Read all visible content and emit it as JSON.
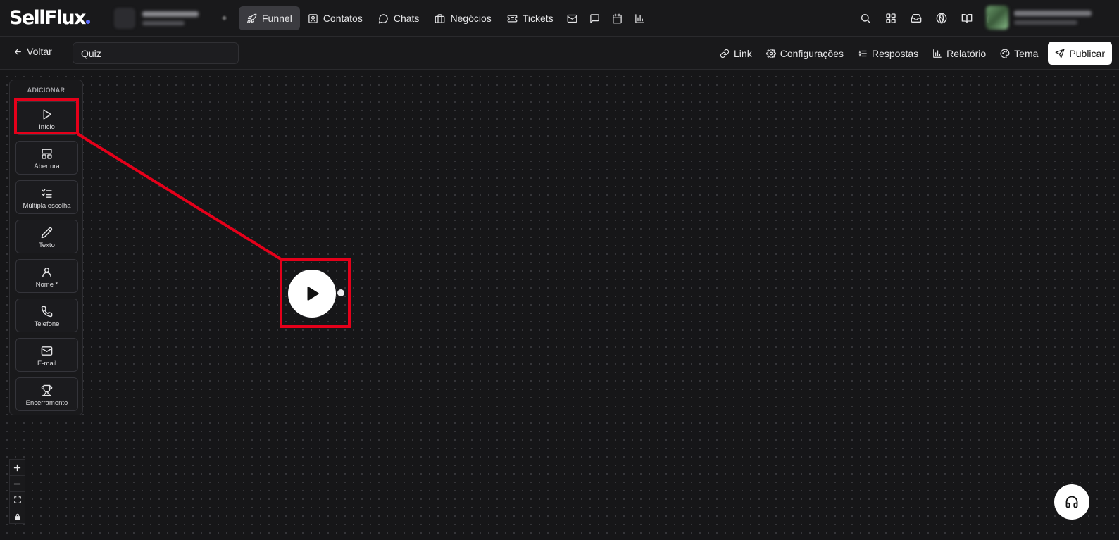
{
  "brand": {
    "name": "SellFlux",
    "dot_color": "#5a6bff"
  },
  "nav": {
    "items": [
      {
        "label": "Funnel",
        "icon": "rocket-icon",
        "active": true
      },
      {
        "label": "Contatos",
        "icon": "contact-card-icon"
      },
      {
        "label": "Chats",
        "icon": "chat-bubble-icon"
      },
      {
        "label": "Negócios",
        "icon": "briefcase-icon"
      },
      {
        "label": "Tickets",
        "icon": "ticket-icon"
      }
    ],
    "extra_icons": [
      "mail-icon",
      "message-square-icon",
      "calendar-icon",
      "bar-chart-icon"
    ]
  },
  "right_icons": [
    "search-icon",
    "apps-grid-icon",
    "inbox-icon",
    "globe-icon",
    "book-icon",
    "headset-icon"
  ],
  "subbar": {
    "back_label": "Voltar",
    "title_value": "Quiz",
    "actions": [
      {
        "label": "Link",
        "icon": "link-icon"
      },
      {
        "label": "Configurações",
        "icon": "gear-icon"
      },
      {
        "label": "Respostas",
        "icon": "list-ordered-icon"
      },
      {
        "label": "Relatório",
        "icon": "bar-chart-icon"
      },
      {
        "label": "Tema",
        "icon": "palette-icon"
      }
    ],
    "publish_label": "Publicar"
  },
  "panel": {
    "header": "ADICIONAR",
    "items": [
      {
        "label": "Início",
        "icon": "play-icon"
      },
      {
        "label": "Abertura",
        "icon": "layout-icon"
      },
      {
        "label": "Múltipla escolha",
        "icon": "checklist-icon"
      },
      {
        "label": "Texto",
        "icon": "pencil-icon"
      },
      {
        "label": "Nome *",
        "icon": "user-icon"
      },
      {
        "label": "Telefone",
        "icon": "phone-icon"
      },
      {
        "label": "E-mail",
        "icon": "mail-icon"
      },
      {
        "label": "Encerramento",
        "icon": "trophy-icon"
      }
    ]
  },
  "canvas": {
    "start_node_icon": "play-icon"
  },
  "zoom_controls": [
    "zoom-in-icon",
    "zoom-out-icon",
    "fit-view-icon",
    "lock-icon"
  ],
  "colors": {
    "highlight": "#e5001a",
    "background": "#161618",
    "active_nav": "#3b3b40"
  }
}
